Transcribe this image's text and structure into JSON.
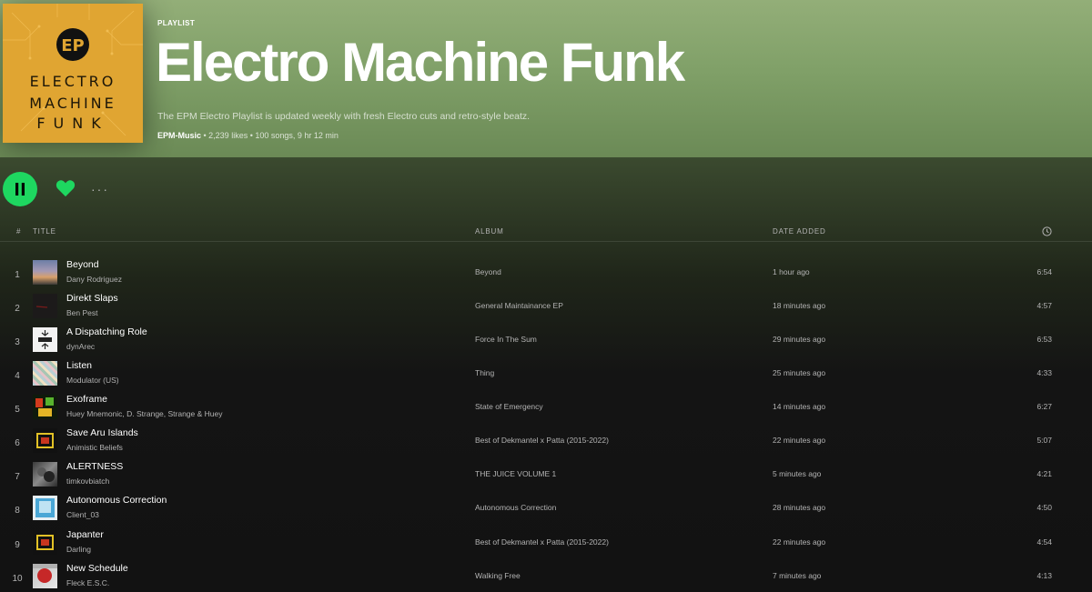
{
  "header": {
    "type_label": "PLAYLIST",
    "title": "Electro Machine Funk",
    "description": "The EPM Electro Playlist is updated weekly with fresh Electro cuts and retro-style beatz.",
    "owner": "EPM-Music",
    "stats": " • 2,239 likes • 100 songs, 9 hr 12 min",
    "cover_lines": [
      "ELECTRO",
      "MACHINE",
      "FUNK"
    ],
    "cover_logo": "EP"
  },
  "actions": {
    "play_icon": "pause-icon",
    "like_icon": "heart-icon",
    "more_label": "···"
  },
  "table": {
    "col_num": "#",
    "col_title": "TITLE",
    "col_album": "ALBUM",
    "col_date": "DATE ADDED",
    "col_duration_icon": "clock-icon"
  },
  "colors": {
    "accent": "#1ed760",
    "hero_bg": "#88a66e",
    "background": "#121212"
  },
  "tracks": [
    {
      "num": "1",
      "title": "Beyond",
      "artist": "Dany Rodriguez",
      "album": "Beyond",
      "date": "1 hour ago",
      "duration": "6:54"
    },
    {
      "num": "2",
      "title": "Direkt Slaps",
      "artist": "Ben Pest",
      "album": "General Maintainance EP",
      "date": "18 minutes ago",
      "duration": "4:57"
    },
    {
      "num": "3",
      "title": "A Dispatching Role",
      "artist": "dynArec",
      "album": "Force In The Sum",
      "date": "29 minutes ago",
      "duration": "6:53"
    },
    {
      "num": "4",
      "title": "Listen",
      "artist": "Modulator (US)",
      "album": "Thing",
      "date": "25 minutes ago",
      "duration": "4:33"
    },
    {
      "num": "5",
      "title": "Exoframe",
      "artist": "Huey Mnemonic, D. Strange, Strange & Huey",
      "album": "State of Emergency",
      "date": "14 minutes ago",
      "duration": "6:27"
    },
    {
      "num": "6",
      "title": "Save Aru Islands",
      "artist": "Animistic Beliefs",
      "album": "Best of Dekmantel x Patta (2015-2022)",
      "date": "22 minutes ago",
      "duration": "5:07"
    },
    {
      "num": "7",
      "title": "ALERTNESS",
      "artist": "timkovbiatch",
      "album": "THE JUICE VOLUME 1",
      "date": "5 minutes ago",
      "duration": "4:21"
    },
    {
      "num": "8",
      "title": "Autonomous Correction",
      "artist": "Client_03",
      "album": "Autonomous Correction",
      "date": "28 minutes ago",
      "duration": "4:50"
    },
    {
      "num": "9",
      "title": "Japanter",
      "artist": "Darling",
      "album": "Best of Dekmantel x Patta (2015-2022)",
      "date": "22 minutes ago",
      "duration": "4:54"
    },
    {
      "num": "10",
      "title": "New Schedule",
      "artist": "Fleck E.S.C.",
      "album": "Walking Free",
      "date": "7 minutes ago",
      "duration": "4:13"
    }
  ]
}
